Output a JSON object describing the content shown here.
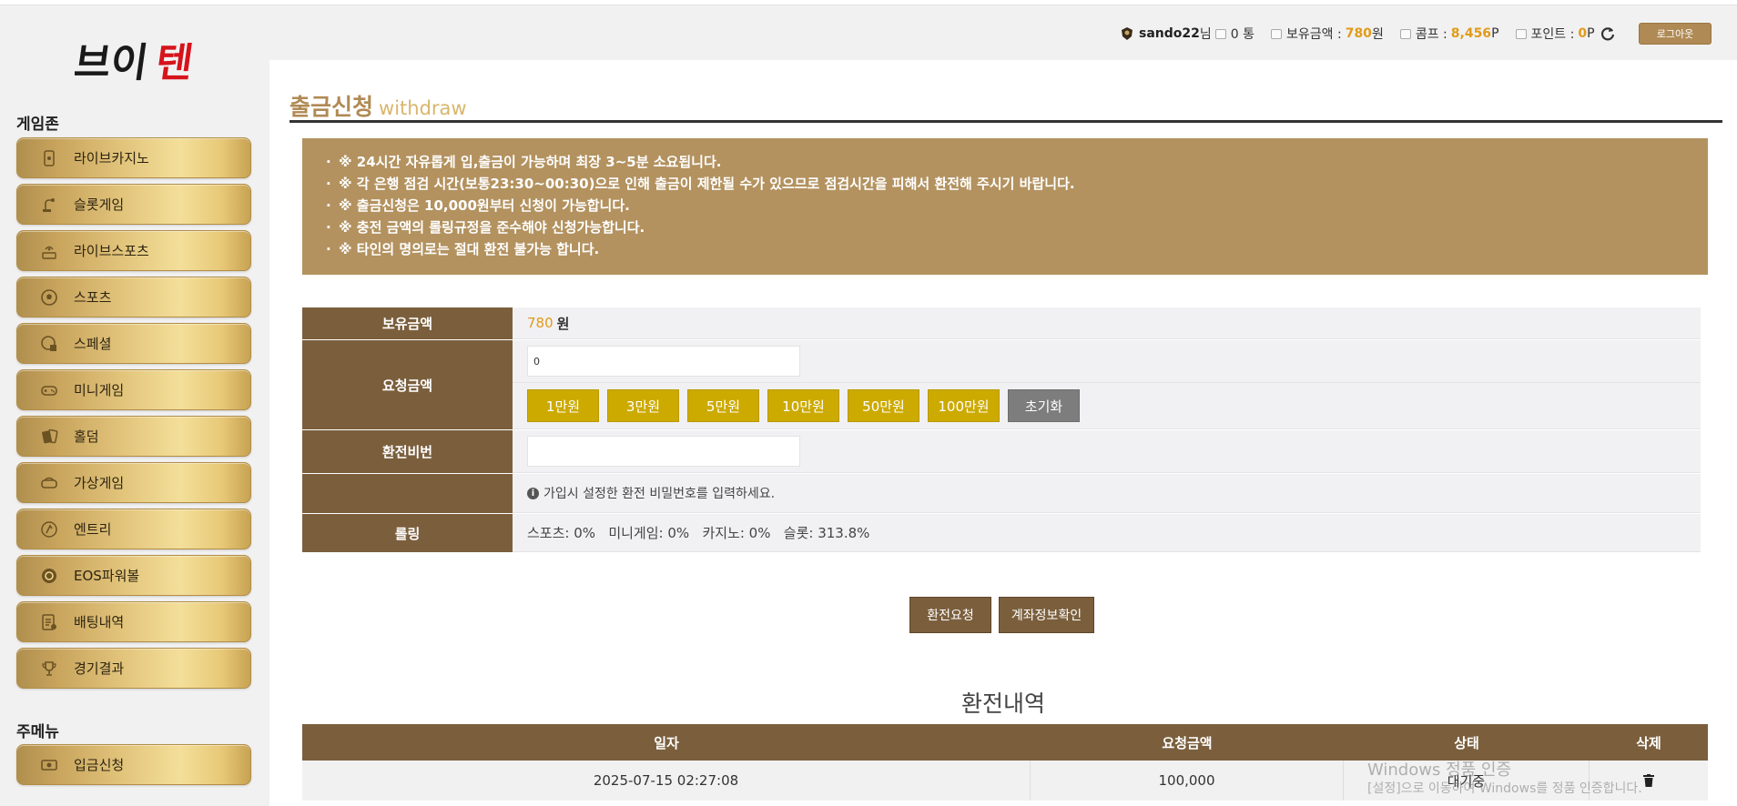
{
  "header": {
    "username": "sando22",
    "user_suffix": "님",
    "message_count": "0 통",
    "balance_label": "보유금액 :",
    "balance_value": "780",
    "balance_unit": "원",
    "comp_label": "콤프 :",
    "comp_value": "8,456",
    "comp_unit": "P",
    "point_label": "포인트 :",
    "point_value": "0",
    "point_unit": "P",
    "logout_label": "로그아웃"
  },
  "logo": {
    "text_left": "브이",
    "text_right": "텐"
  },
  "sidebar": {
    "game_section": "게임존",
    "game_items": [
      {
        "label": "라이브카지노",
        "icon": "card-icon"
      },
      {
        "label": "슬롯게임",
        "icon": "slot-lever-icon"
      },
      {
        "label": "라이브스포츠",
        "icon": "live-icon"
      },
      {
        "label": "스포츠",
        "icon": "soccer-ball-icon"
      },
      {
        "label": "스페셜",
        "icon": "special-ball-icon"
      },
      {
        "label": "미니게임",
        "icon": "gamepad-icon"
      },
      {
        "label": "홀덤",
        "icon": "poker-cards-icon"
      },
      {
        "label": "가상게임",
        "icon": "vr-icon"
      },
      {
        "label": "엔트리",
        "icon": "entry-icon"
      },
      {
        "label": "EOS파워볼",
        "icon": "powerball-icon"
      },
      {
        "label": "배팅내역",
        "icon": "bet-history-icon"
      },
      {
        "label": "경기결과",
        "icon": "trophy-icon"
      }
    ],
    "main_section": "주메뉴",
    "main_items": [
      {
        "label": "입금신청",
        "icon": "money-icon"
      }
    ]
  },
  "page": {
    "title": "출금신청",
    "subtitle": "withdraw",
    "notices": [
      "※ 24시간 자유롭게 입,출금이 가능하며 최장 3~5분 소요됩니다.",
      "※ 각 은행 점검 시간(보통23:30~00:30)으로 인해 출금이 제한될 수가 있으므로 점검시간을 피해서 환전해 주시기 바랍니다.",
      "※ 출금신청은 10,000원부터 신청이 가능합니다.",
      "※ 충전 금액의 롤링규정을 준수해야 신청가능합니다.",
      "※ 타인의 명의로는 절대 환전 불가능 합니다."
    ]
  },
  "form": {
    "balance_label": "보유금액",
    "balance_value": "780",
    "balance_unit": "원",
    "request_label": "요청금액",
    "request_value": "0",
    "amount_buttons": [
      "1만원",
      "3만원",
      "5만원",
      "10만원",
      "50만원",
      "100만원"
    ],
    "reset_label": "초기화",
    "pin_label": "환전비번",
    "pin_value": "",
    "pin_hint": "가입시 설정한 환전 비밀번호를 입력하세요.",
    "rolling_label": "롤링",
    "rolling_text": "스포츠: 0%   미니게임: 0%   카지노: 0%   슬롯: 313.8%"
  },
  "actions": {
    "submit_label": "환전요청",
    "account_label": "계좌정보확인"
  },
  "history": {
    "title": "환전내역",
    "columns": [
      "일자",
      "요청금액",
      "상태",
      "삭제"
    ],
    "rows": [
      {
        "date": "2025-07-15 02:27:08",
        "amount": "100,000",
        "status": "대기중"
      }
    ]
  },
  "watermark": {
    "line1": "Windows 정품 인증",
    "line2": "[설정]으로 이동하여 Windows를 정품 인증합니다."
  },
  "colors": {
    "accent": "#b08a55",
    "table_header": "#7b5f3d",
    "notice_bg": "#b3925f",
    "amount_button": "#ccaa00",
    "highlight": "#e19b19"
  }
}
